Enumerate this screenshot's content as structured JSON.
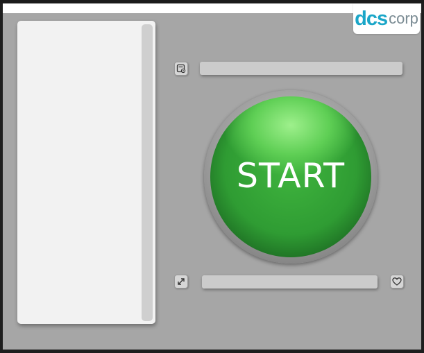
{
  "logo": {
    "part_a": "dcs",
    "part_b": "corp",
    "color_a": "#1aa6c8",
    "color_b": "#7a8b93"
  },
  "start_button": {
    "label": "START",
    "color": "#36a83a"
  },
  "icons": {
    "top_left": "gear-document-icon",
    "bottom_left": "expand-arrows-icon",
    "bottom_right": "heart-icon"
  },
  "fields": {
    "top_value": "",
    "bottom_value": ""
  }
}
